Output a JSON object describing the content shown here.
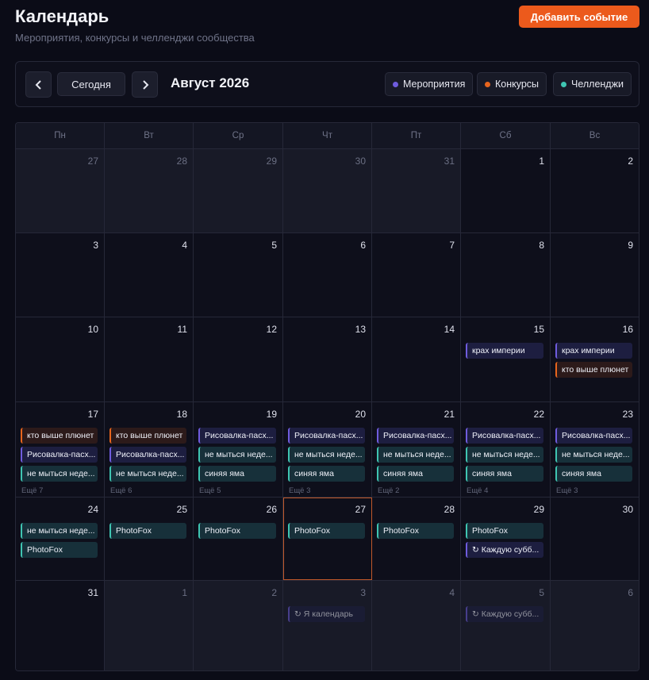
{
  "header": {
    "title": "Календарь",
    "subtitle": "Мероприятия, конкурсы и челленджи сообщества",
    "add_button": "Добавить событие"
  },
  "toolbar": {
    "prev_icon": "chevron-left-icon",
    "next_icon": "chevron-right-icon",
    "today_label": "Сегодня",
    "month_label": "Август 2026",
    "legend": [
      {
        "label": "Мероприятия",
        "color": "#6f5cde"
      },
      {
        "label": "Конкурсы",
        "color": "#e8651d"
      },
      {
        "label": "Челленджи",
        "color": "#3fc5b2"
      }
    ]
  },
  "weekdays": [
    "Пн",
    "Вт",
    "Ср",
    "Чт",
    "Пт",
    "Сб",
    "Вс"
  ],
  "weeks": [
    [
      {
        "day": "27",
        "muted": true,
        "events": []
      },
      {
        "day": "28",
        "muted": true,
        "events": []
      },
      {
        "day": "29",
        "muted": true,
        "events": []
      },
      {
        "day": "30",
        "muted": true,
        "events": []
      },
      {
        "day": "31",
        "muted": true,
        "events": []
      },
      {
        "day": "1",
        "events": []
      },
      {
        "day": "2",
        "events": []
      }
    ],
    [
      {
        "day": "3",
        "events": []
      },
      {
        "day": "4",
        "events": []
      },
      {
        "day": "5",
        "events": []
      },
      {
        "day": "6",
        "events": []
      },
      {
        "day": "7",
        "events": []
      },
      {
        "day": "8",
        "events": []
      },
      {
        "day": "9",
        "events": []
      }
    ],
    [
      {
        "day": "10",
        "events": []
      },
      {
        "day": "11",
        "events": []
      },
      {
        "day": "12",
        "events": []
      },
      {
        "day": "13",
        "events": []
      },
      {
        "day": "14",
        "events": []
      },
      {
        "day": "15",
        "events": [
          {
            "title": "крах империи",
            "kind": "purple"
          }
        ]
      },
      {
        "day": "16",
        "events": [
          {
            "title": "крах империи",
            "kind": "purple"
          },
          {
            "title": "кто выше плюнет",
            "kind": "orange"
          }
        ]
      }
    ],
    [
      {
        "day": "17",
        "events": [
          {
            "title": "кто выше плюнет",
            "kind": "orange"
          },
          {
            "title": "Рисовалка-пасх...",
            "kind": "purple"
          },
          {
            "title": "не мыться неде...",
            "kind": "teal"
          }
        ],
        "more": "Ещё 7"
      },
      {
        "day": "18",
        "events": [
          {
            "title": "кто выше плюнет",
            "kind": "orange"
          },
          {
            "title": "Рисовалка-пасх...",
            "kind": "purple"
          },
          {
            "title": "не мыться неде...",
            "kind": "teal"
          }
        ],
        "more": "Ещё 6"
      },
      {
        "day": "19",
        "events": [
          {
            "title": "Рисовалка-пасх...",
            "kind": "purple"
          },
          {
            "title": "не мыться неде...",
            "kind": "teal"
          },
          {
            "title": "синяя яма",
            "kind": "teal"
          }
        ],
        "more": "Ещё 5"
      },
      {
        "day": "20",
        "events": [
          {
            "title": "Рисовалка-пасх...",
            "kind": "purple"
          },
          {
            "title": "не мыться неде...",
            "kind": "teal"
          },
          {
            "title": "синяя яма",
            "kind": "teal"
          }
        ],
        "more": "Ещё 3"
      },
      {
        "day": "21",
        "events": [
          {
            "title": "Рисовалка-пасх...",
            "kind": "purple"
          },
          {
            "title": "не мыться неде...",
            "kind": "teal"
          },
          {
            "title": "синяя яма",
            "kind": "teal"
          }
        ],
        "more": "Ещё 2"
      },
      {
        "day": "22",
        "events": [
          {
            "title": "Рисовалка-пасх...",
            "kind": "purple"
          },
          {
            "title": "не мыться неде...",
            "kind": "teal"
          },
          {
            "title": "синяя яма",
            "kind": "teal"
          }
        ],
        "more": "Ещё 4"
      },
      {
        "day": "23",
        "events": [
          {
            "title": "Рисовалка-пасх...",
            "kind": "purple"
          },
          {
            "title": "не мыться неде...",
            "kind": "teal"
          },
          {
            "title": "синяя яма",
            "kind": "teal"
          }
        ],
        "more": "Ещё 3"
      }
    ],
    [
      {
        "day": "24",
        "events": [
          {
            "title": "не мыться неде...",
            "kind": "teal"
          },
          {
            "title": "PhotoFox",
            "kind": "teal"
          }
        ]
      },
      {
        "day": "25",
        "events": [
          {
            "title": "PhotoFox",
            "kind": "teal"
          }
        ]
      },
      {
        "day": "26",
        "events": [
          {
            "title": "PhotoFox",
            "kind": "teal"
          }
        ]
      },
      {
        "day": "27",
        "today": true,
        "events": [
          {
            "title": "PhotoFox",
            "kind": "teal"
          }
        ]
      },
      {
        "day": "28",
        "events": [
          {
            "title": "PhotoFox",
            "kind": "teal"
          }
        ]
      },
      {
        "day": "29",
        "events": [
          {
            "title": "PhotoFox",
            "kind": "teal"
          },
          {
            "title": "↻ Каждую субб...",
            "kind": "purple"
          }
        ]
      },
      {
        "day": "30",
        "events": []
      }
    ],
    [
      {
        "day": "31",
        "events": []
      },
      {
        "day": "1",
        "muted": true,
        "events": []
      },
      {
        "day": "2",
        "muted": true,
        "events": []
      },
      {
        "day": "3",
        "muted": true,
        "events": [
          {
            "title": "↻ Я календарь",
            "kind": "purple",
            "faded": true
          }
        ]
      },
      {
        "day": "4",
        "muted": true,
        "events": []
      },
      {
        "day": "5",
        "muted": true,
        "events": [
          {
            "title": "↻ Каждую субб...",
            "kind": "purple",
            "faded": true
          }
        ]
      },
      {
        "day": "6",
        "muted": true,
        "events": []
      }
    ]
  ]
}
